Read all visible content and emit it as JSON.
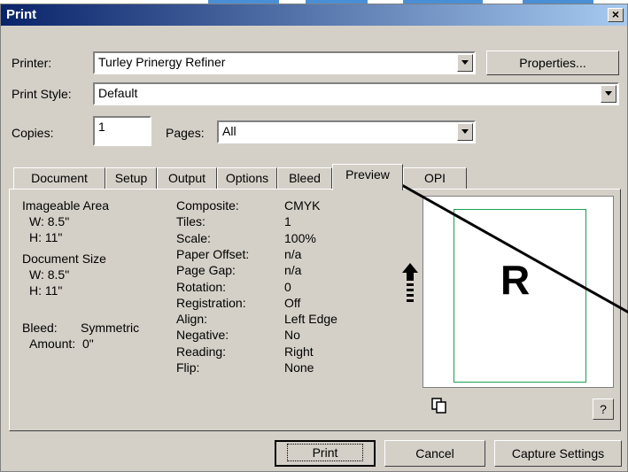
{
  "dialog": {
    "title": "Print",
    "close_glyph": "×"
  },
  "printer": {
    "label": "Printer:",
    "value": "Turley Prinergy Refiner",
    "properties_button": "Properties..."
  },
  "print_style": {
    "label": "Print Style:",
    "value": "Default"
  },
  "copies": {
    "label": "Copies:",
    "value": "1"
  },
  "pages": {
    "label": "Pages:",
    "value": "All"
  },
  "tabs": [
    "Document",
    "Setup",
    "Output",
    "Options",
    "Bleed",
    "Preview",
    "OPI"
  ],
  "active_tab": "Preview",
  "summary": {
    "imageable_area_title": "Imageable Area",
    "imageable_w": "W: 8.5\"",
    "imageable_h": "H: 11\"",
    "document_size_title": "Document Size",
    "document_w": "W: 8.5\"",
    "document_h": "H: 11\"",
    "bleed_label": "Bleed:",
    "bleed_value": "Symmetric",
    "amount_label": "Amount:",
    "amount_value": "0\""
  },
  "settings": [
    {
      "label": "Composite:",
      "value": "CMYK"
    },
    {
      "label": "Tiles:",
      "value": "1"
    },
    {
      "label": "Scale:",
      "value": "100%"
    },
    {
      "label": "Paper Offset:",
      "value": "n/a"
    },
    {
      "label": "Page Gap:",
      "value": "n/a"
    },
    {
      "label": "Rotation:",
      "value": "0"
    },
    {
      "label": "Registration:",
      "value": "Off"
    },
    {
      "label": "Align:",
      "value": "Left Edge"
    },
    {
      "label": "Negative:",
      "value": "No"
    },
    {
      "label": "Reading:",
      "value": "Right"
    },
    {
      "label": "Flip:",
      "value": "None"
    }
  ],
  "preview": {
    "glyph": "R",
    "help_button": "?"
  },
  "footer": {
    "print": "Print",
    "cancel": "Cancel",
    "capture": "Capture Settings"
  },
  "icons": {
    "orientation": "up-arrow-icon",
    "pages": "copy-pages-icon"
  },
  "colors": {
    "title_start": "#0a246a",
    "title_end": "#a6caf0",
    "page_border": "#1aa050",
    "dialog_bg": "#d4d0c8"
  }
}
